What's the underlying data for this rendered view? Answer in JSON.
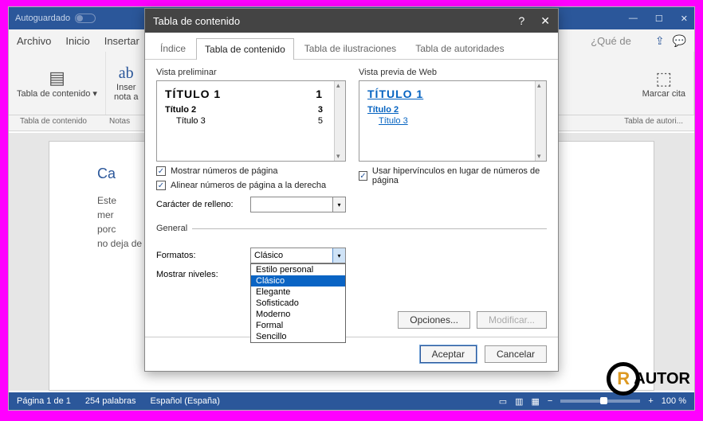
{
  "titlebar": {
    "autosave": "Autoguardado"
  },
  "menu": {
    "file": "Archivo",
    "home": "Inicio",
    "insert": "Insertar",
    "ask": "¿Qué de"
  },
  "ribbon": {
    "toc_btn": "Tabla de contenido",
    "toc_arrow": "▾",
    "note1": "Inser",
    "note2": "nota a",
    "ab": "ab",
    "mark": "Marcar cita",
    "cap_toc": "Tabla de contenido",
    "cap_notas": "Notas",
    "cap_auth": "Tabla de autori..."
  },
  "doc": {
    "heading": "Ca",
    "p1": "Este",
    "p2": "mer",
    "p3": "porc",
    "p4": "no deja de ser un texto de prueba."
  },
  "status": {
    "page": "Página 1 de 1",
    "words": "254 palabras",
    "lang": "Español (España)",
    "zoom": "100 %"
  },
  "dialog": {
    "title": "Tabla de contenido",
    "tabs": {
      "t1": "Índice",
      "t2": "Tabla de contenido",
      "t3": "Tabla de ilustraciones",
      "t4": "Tabla de autoridades"
    },
    "preview_label": "Vista preliminar",
    "web_label": "Vista previa de Web",
    "pv": {
      "t1": "TÍTULO 1",
      "n1": "1",
      "t2": "Título 2",
      "n2": "3",
      "t3": "Título 3",
      "n3": "5"
    },
    "chk_pagenum": "Mostrar números de página",
    "chk_align": "Alinear números de página a la derecha",
    "chk_hyper": "Usar hipervínculos en lugar de números de página",
    "fill_label": "Carácter de relleno:",
    "general": "General",
    "formats_label": "Formatos:",
    "formats_value": "Clásico",
    "levels_label": "Mostrar niveles:",
    "dropdown": [
      "Estilo personal",
      "Clásico",
      "Elegante",
      "Sofisticado",
      "Moderno",
      "Formal",
      "Sencillo"
    ],
    "btn_options": "Opciones...",
    "btn_modify": "Modificar...",
    "btn_ok": "Aceptar",
    "btn_cancel": "Cancelar"
  },
  "logo": {
    "r": "R",
    "text": "AUTOR"
  }
}
